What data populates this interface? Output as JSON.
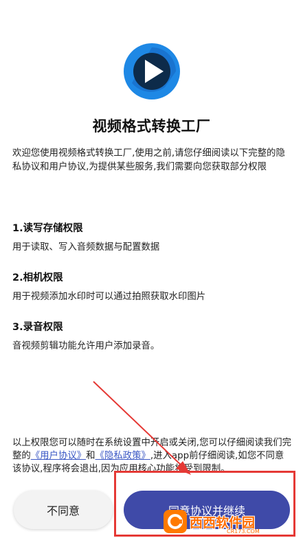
{
  "app": {
    "title": "视频格式转换工厂",
    "accent_color": "#1e88e5"
  },
  "intro": "欢迎您使用视频格式转换工厂,使用之前,请您仔细阅读以下完整的隐私协议和用户协议,为提供某些服务,我们需要向您获取部分权限",
  "permissions": [
    {
      "title": "1.读写存储权限",
      "desc": "用于读取、写入音频数据与配置数据"
    },
    {
      "title": "2.相机权限",
      "desc": "用于视频添加水印时可以通过拍照获取水印图片"
    },
    {
      "title": "3.录音权限",
      "desc": "音视频剪辑功能允许用户添加录音。"
    }
  ],
  "footer": {
    "part1": "以上权限您可以随时在系统设置中开启或关闭,您可以仔细阅读我们完整的",
    "user_agreement": "《用户协议》",
    "and": "和",
    "privacy_policy": "《隐私政策》",
    "part2": ",进入app前仔细阅读,如您不同意该协议,程序将会退出,因为应用核心功能将受到限制。"
  },
  "buttons": {
    "disagree": "不同意",
    "agree": "同意协议并继续"
  },
  "watermark": {
    "text": "西西软件园",
    "url": "CR173.COM"
  }
}
